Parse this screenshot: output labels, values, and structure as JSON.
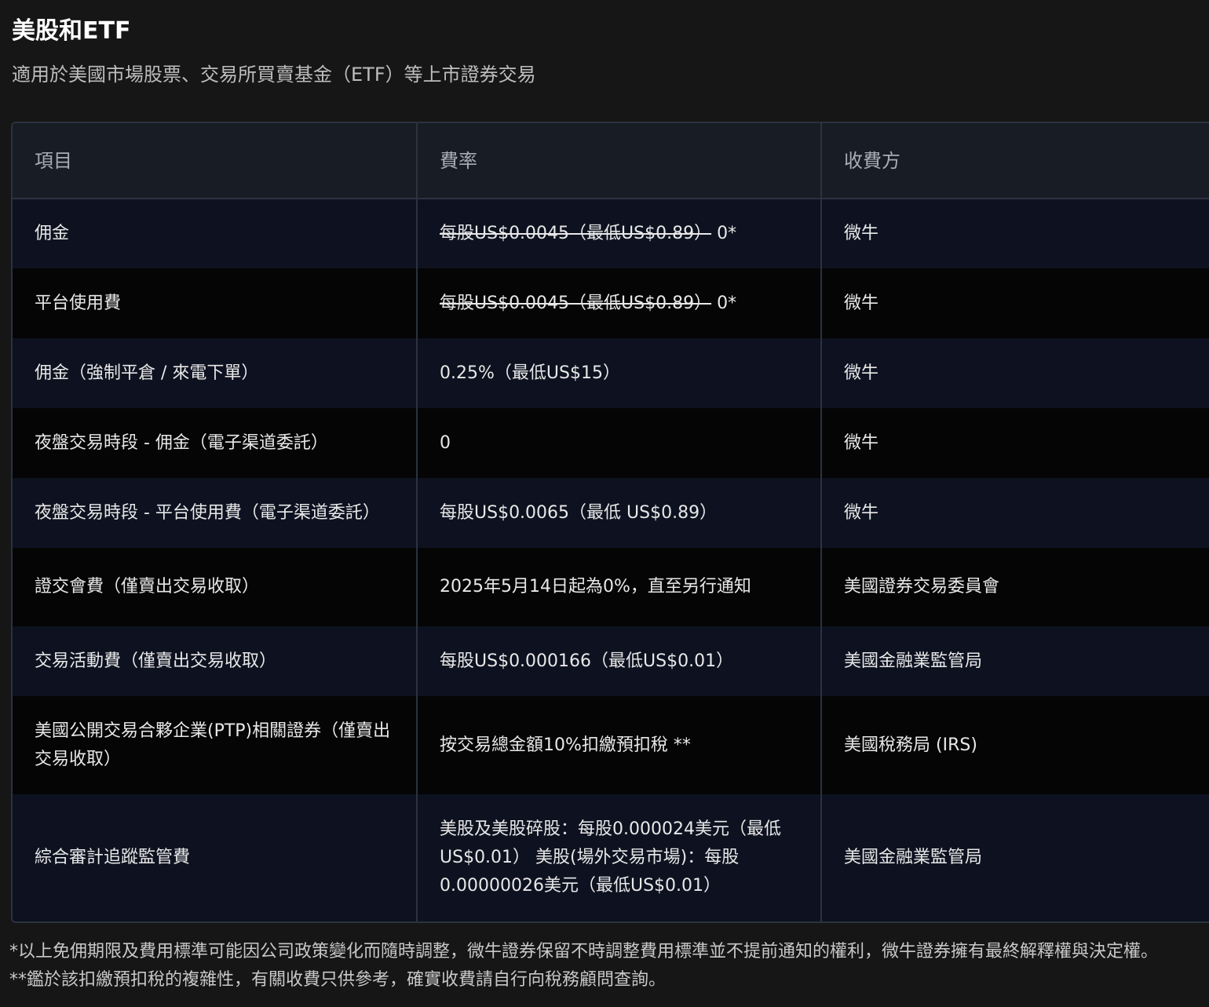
{
  "section": {
    "title": "美股和ETF",
    "subtitle": "適用於美國市場股票、交易所買賣基金（ETF）等上市證券交易"
  },
  "table": {
    "headers": [
      "項目",
      "費率",
      "收費方"
    ],
    "rows": [
      {
        "item": "佣金",
        "rate_struck": "每股US$0.0045（最低US$0.89）",
        "rate": " 0*",
        "payee": "微牛"
      },
      {
        "item": "平台使用費",
        "rate_struck": "每股US$0.0045（最低US$0.89）",
        "rate": " 0*",
        "payee": "微牛"
      },
      {
        "item": "佣金（強制平倉 / 來電下單）",
        "rate": "0.25%（最低US$15）",
        "payee": "微牛"
      },
      {
        "item": "夜盤交易時段 - 佣金（電子渠道委託）",
        "rate": "0",
        "payee": "微牛"
      },
      {
        "item": "夜盤交易時段 - 平台使用費（電子渠道委託）",
        "rate": "每股US$0.0065（最低 US$0.89）",
        "payee": "微牛"
      },
      {
        "item": "證交會費（僅賣出交易收取）",
        "rate": "2025年5月14日起為0%，直至另行通知",
        "payee": "美國證券交易委員會"
      },
      {
        "item": "交易活動費（僅賣出交易收取）",
        "rate": "每股US$0.000166（最低US$0.01）",
        "payee": "美國金融業監管局"
      },
      {
        "item": "美國公開交易合夥企業(PTP)相關證券（僅賣出交易收取）",
        "rate": "按交易總金額10%扣繳預扣稅 **",
        "payee": "美國稅務局 (IRS)"
      },
      {
        "item": "綜合審計追蹤監管費",
        "rate": "美股及美股碎股：每股0.000024美元（最低US$0.01） 美股(場外交易市場)：每股0.00000026美元（最低US$0.01）",
        "payee": "美國金融業監管局"
      }
    ]
  },
  "footnotes": {
    "note1": "*以上免佣期限及費用標準可能因公司政策變化而隨時調整，微牛證券保留不時調整費用標準並不提前通知的權利，微牛證券擁有最終解釋權與決定權。",
    "note2": "**鑑於該扣繳預扣稅的複雜性，有關收費只供參考，確實收費請自行向稅務顧問查詢。"
  }
}
